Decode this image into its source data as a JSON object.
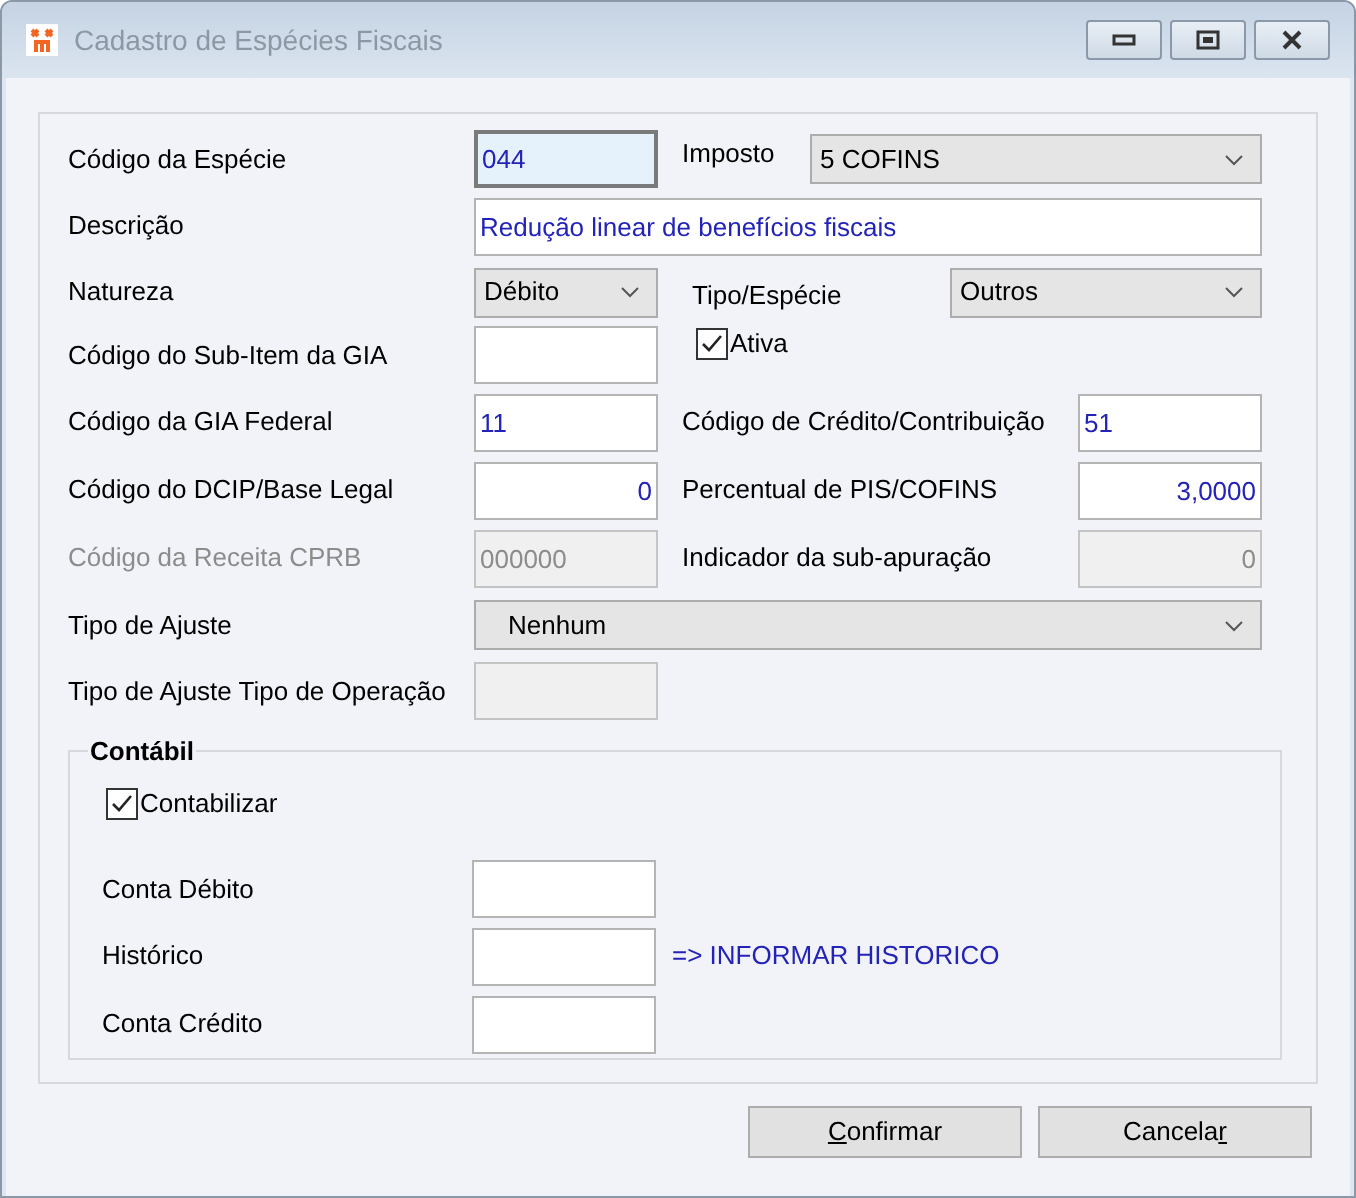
{
  "window": {
    "title": "Cadastro de Espécies Fiscais"
  },
  "codigo_especie": {
    "label": "Código da Espécie",
    "value": "044",
    "focused": true
  },
  "imposto": {
    "label": "Imposto",
    "value": "5 COFINS"
  },
  "descricao": {
    "label": "Descrição",
    "value": "Redução linear de benefícios fiscais"
  },
  "natureza": {
    "label": "Natureza",
    "value": "Débito"
  },
  "tipo_especie": {
    "label": "Tipo/Espécie",
    "value": "Outros"
  },
  "sub_item_gia": {
    "label": "Código do Sub-Item da GIA"
  },
  "ativa": {
    "label": "Ativa",
    "checked": true
  },
  "gia_federal": {
    "label": "Código da GIA Federal",
    "value": "11"
  },
  "credito_contribuicao": {
    "label": "Código de Crédito/Contribuição",
    "value": "51"
  },
  "dcip": {
    "label": "Código do DCIP/Base Legal",
    "value": "0"
  },
  "percentual": {
    "label": "Percentual de PIS/COFINS",
    "value": "3,0000"
  },
  "receita_cprb": {
    "label": "Código da Receita CPRB",
    "value": "000000",
    "disabled": true
  },
  "sub_apuracao": {
    "label": "Indicador da sub-apuração",
    "value": "0",
    "disabled": true
  },
  "tipo_ajuste": {
    "label": "Tipo de Ajuste",
    "value": "Nenhum"
  },
  "tipo_operacao": {
    "label": "Tipo de Ajuste Tipo de Operação",
    "disabled": true
  },
  "contabil": {
    "title": "Contábil",
    "contabilizar": {
      "label": "Contabilizar",
      "checked": true
    },
    "conta_debito": {
      "label": "Conta Débito"
    },
    "historico": {
      "label": "Histórico",
      "hint": "=> INFORMAR HISTORICO"
    },
    "conta_credito": {
      "label": "Conta Crédito"
    }
  },
  "buttons": [
    {
      "key": "C",
      "after": "onfirmar"
    },
    {
      "before": "Cancela",
      "key": "r"
    }
  ]
}
